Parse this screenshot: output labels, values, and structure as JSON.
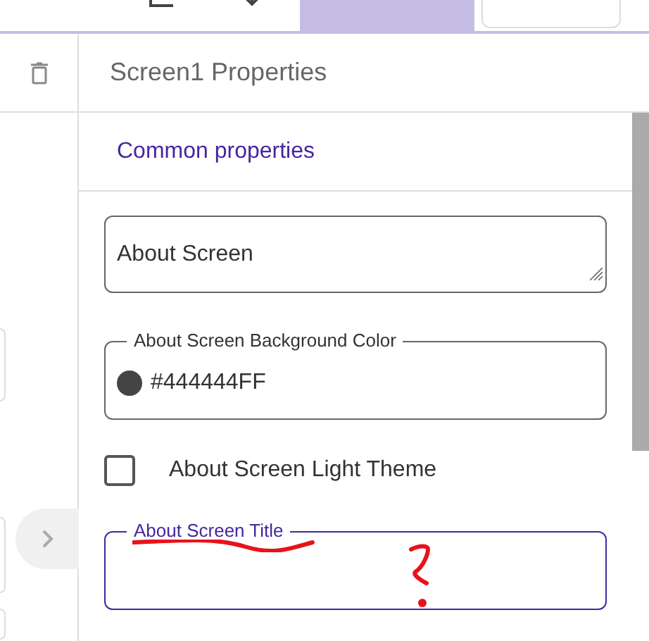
{
  "top_tabs": [
    {
      "selected": true
    },
    {
      "selected": false
    }
  ],
  "panel": {
    "title": "Screen1 Properties",
    "section": "Common properties"
  },
  "properties": [
    {
      "kind": "textarea",
      "value": "About Screen"
    },
    {
      "kind": "color",
      "label": "About Screen Background Color",
      "value": "#444444FF",
      "color": "#444444"
    },
    {
      "kind": "checkbox",
      "label": "About Screen Light Theme",
      "checked": false
    },
    {
      "kind": "text",
      "label": "About Screen Title",
      "focused": true
    }
  ]
}
